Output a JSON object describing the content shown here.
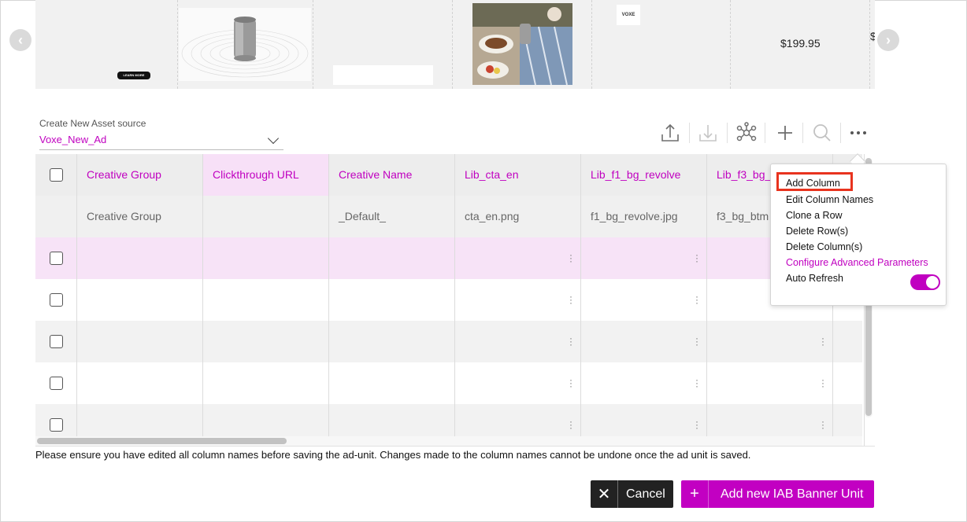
{
  "carousel": {
    "price_text": "$199.95",
    "price_text_2": "$",
    "learn_more": "LEARN MORE",
    "logo": "VOXE"
  },
  "asset_source": {
    "label": "Create New Asset source",
    "value": "Voxe_New_Ad"
  },
  "toolbar": {
    "icons": [
      "upload-icon",
      "download-icon",
      "network-icon",
      "plus-icon",
      "search-icon",
      "more-icon"
    ]
  },
  "grid": {
    "columns": [
      "Creative Group",
      "Clickthrough URL",
      "Creative Name",
      "Lib_cta_en",
      "Lib_f1_bg_revolve",
      "Lib_f3_bg_"
    ],
    "default_row": [
      "Creative Group",
      "",
      "_Default_",
      "cta_en.png",
      "f1_bg_revolve.jpg",
      "f3_bg_btm"
    ]
  },
  "menu": {
    "items": [
      "Add Column",
      "Edit Column Names",
      "Clone a Row",
      "Delete Row(s)",
      "Delete Column(s)",
      "Configure Advanced Parameters",
      "Auto Refresh"
    ],
    "auto_refresh_on": true
  },
  "note": "Please ensure you have edited all column names before saving the ad-unit. Changes made to the column names cannot be undone once the ad unit is saved.",
  "buttons": {
    "cancel": "Cancel",
    "add": "Add new IAB Banner Unit"
  },
  "colors": {
    "accent": "#c000c0",
    "highlight": "#e8331e"
  }
}
